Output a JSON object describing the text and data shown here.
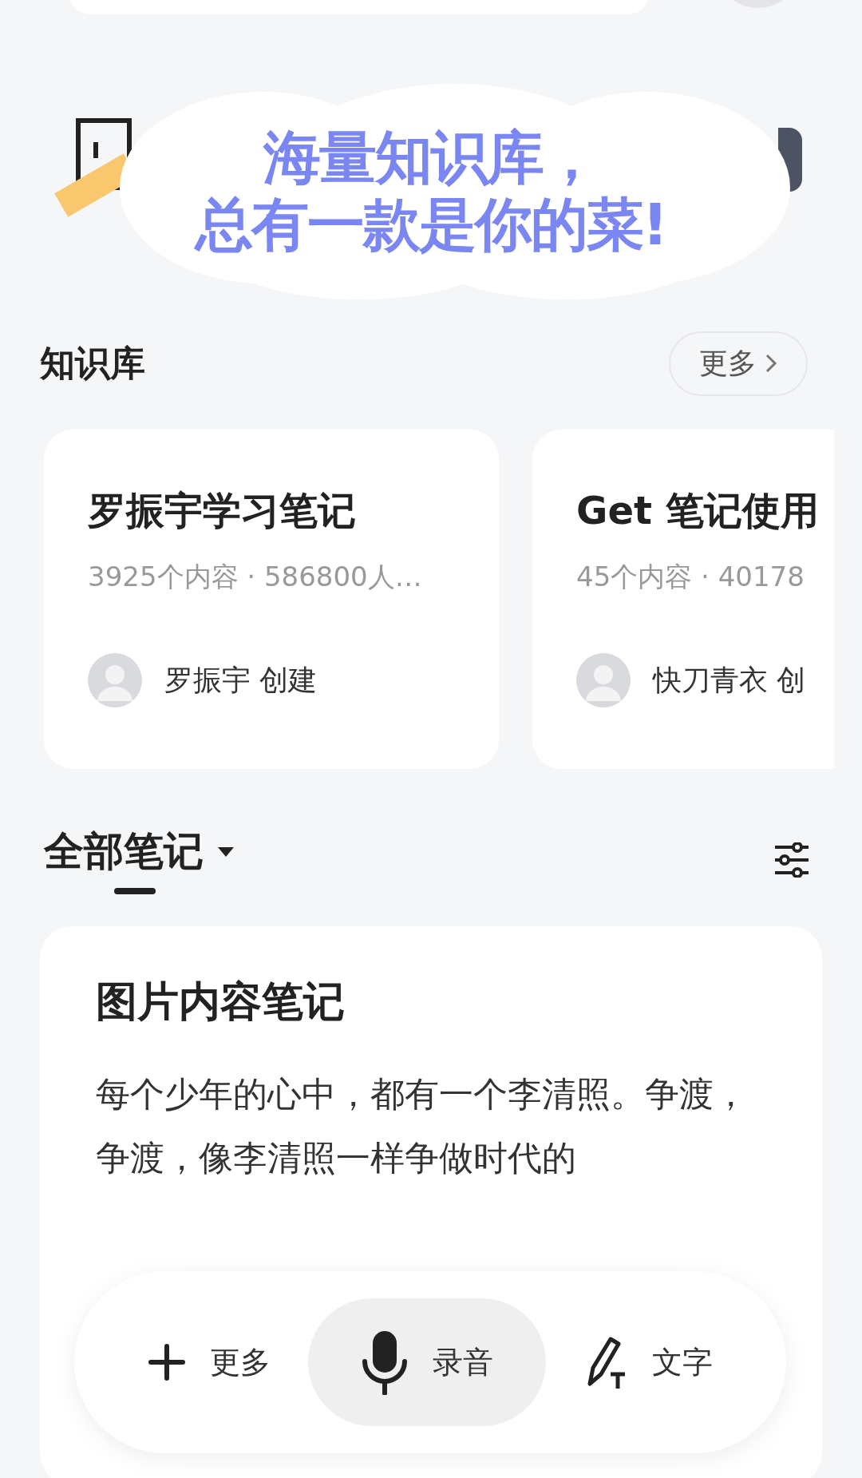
{
  "caption": {
    "lines": [
      "海量知识库，",
      "总有一款是你的菜!"
    ]
  },
  "knowledge": {
    "title": "知识库",
    "more": "更多",
    "cards": [
      {
        "title": "罗振宇学习笔记",
        "meta": "3925个内容 · 586800人…",
        "author": "罗振宇 创建"
      },
      {
        "title": "Get 笔记使用",
        "meta": "45个内容 · 40178",
        "author": "快刀青衣 创"
      }
    ]
  },
  "notes": {
    "filter": "全部笔记",
    "note": {
      "title": "图片内容笔记",
      "body": "每个少年的心中，都有一个李清照。争渡，争渡，像李清照一样争做时代的"
    }
  },
  "toolbar": [
    {
      "kind": "more",
      "label": "更多",
      "selected": false
    },
    {
      "kind": "record",
      "label": "录音",
      "selected": true
    },
    {
      "kind": "text",
      "label": "文字",
      "selected": false
    }
  ]
}
